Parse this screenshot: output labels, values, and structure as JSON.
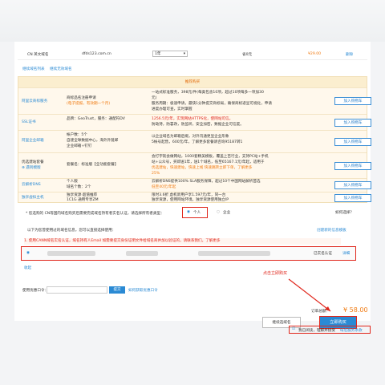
{
  "domain_row": {
    "type": "CN 英文域名",
    "name": "dfds123.com.cn",
    "period": "1年",
    "saving": "省0元",
    "price": "¥29.00",
    "delete": "删除"
  },
  "links": {
    "continue_register": "继续域名列表",
    "unregistered": "继续无效域名"
  },
  "recommend": {
    "header": "推荐购买",
    "add_label": "加入购物车",
    "rows": [
      {
        "name": "阿里云商标服务",
        "desc1": "商标品名注册申请",
        "desc2": "(电子提报，有效期一个月)",
        "detail1": "一站式标准服务，398元/件(每类包含10项，超过10项每多一项加30",
        "detail2": "元)",
        "detail3": "服务周期：极速申请，最快1分钟提交商标局，确保商标递呈可视化，申请",
        "detail4": "进度办理可查，实时掌握"
      },
      {
        "name": "SSL证书",
        "desc1": "品牌：GeoTrust，服务：通配符DV",
        "desc2": "",
        "detail1": "1256.5元/年，实现网站HTTPS化，使网站可信。",
        "detail2": "防劫持，防篡改，防监听，安全加密，数据企业可信度。"
      },
      {
        "name": "阿里企业邮箱",
        "desc1": "帐户数：5个",
        "desc2": "自建全球数据中心，海外外链邮",
        "desc3": "企业邮箱+钉钉",
        "detail1": "以企业域名为邮箱后缀，对外沟通更显企业形象",
        "detail2": "5帐号起售，600元/年，了解更多套餐请咨询95187转1"
      },
      {
        "name": "优选建站套餐",
        "desc1": "套餐名：标准版【全功能套餐】",
        "extra": "⊕ 遇到模版",
        "detail1": "会打字就会做网站，1000套精美模板，覆盖上百行业，支持PC站+手机",
        "detail2": "站+公众号，买即送1年，送1个域名，低至65167.1元/年起，适用于",
        "detail3": "优选建站，快速建站，快速上线 快速跳转立即下单，了解更多",
        "detail4": "25%"
      },
      {
        "name": "云解析DNS",
        "desc1": "个人版",
        "desc2": "域名个数：2个",
        "detail1": "云解析DNS提供100% SLA服务保障，超过10个中国网站解析首选",
        "detail2": "低至40元/年起"
      },
      {
        "name": "独享虚拟主机",
        "desc1": "独享资源·超值推荐",
        "desc2": "1C1G 通用专享ZM",
        "detail1": "限时3.6折 虚机新用户享1.597元/年，同一台",
        "detail2": "独享资源，使用网站环境，独享资源使用独立IP"
      }
    ]
  },
  "owner_question": "* 您选购的 CN等国内域名购买后需要完成域名持有者实名认证，请选择所有者类型：",
  "radio_personal": "个人",
  "radio_company": "企业",
  "how_choose": "如何选择？",
  "info_line": "以下为您曾使用过的域名信息，您可以直接选择使用：",
  "create_new": "创建新的信息模板",
  "tip": "1. 使用CANN域名实名认证，域名持有人Email 如需要提交身份证明文件给域名商并加以验证的，请联系我们。了解更多",
  "certified": "已实名认证",
  "detail_link": "详细",
  "collapse": "收起",
  "coupon_label": "使用优惠口令：",
  "coupon_placeholder": "",
  "use_btn": "提交",
  "coupon_help": "如何获取优惠口令",
  "annotation": "点击立即购买",
  "total_label": "订单总额：",
  "total_value": "¥ 58.00",
  "cart_btn": "继续选域名",
  "buy_btn": "立即购买",
  "agree_text": "我已阅读，理解并接受",
  "agree_link": "域名服务条款",
  "colors": {
    "blue": "#2a8ad4",
    "orange": "#f07b13",
    "red": "#e0261b"
  }
}
